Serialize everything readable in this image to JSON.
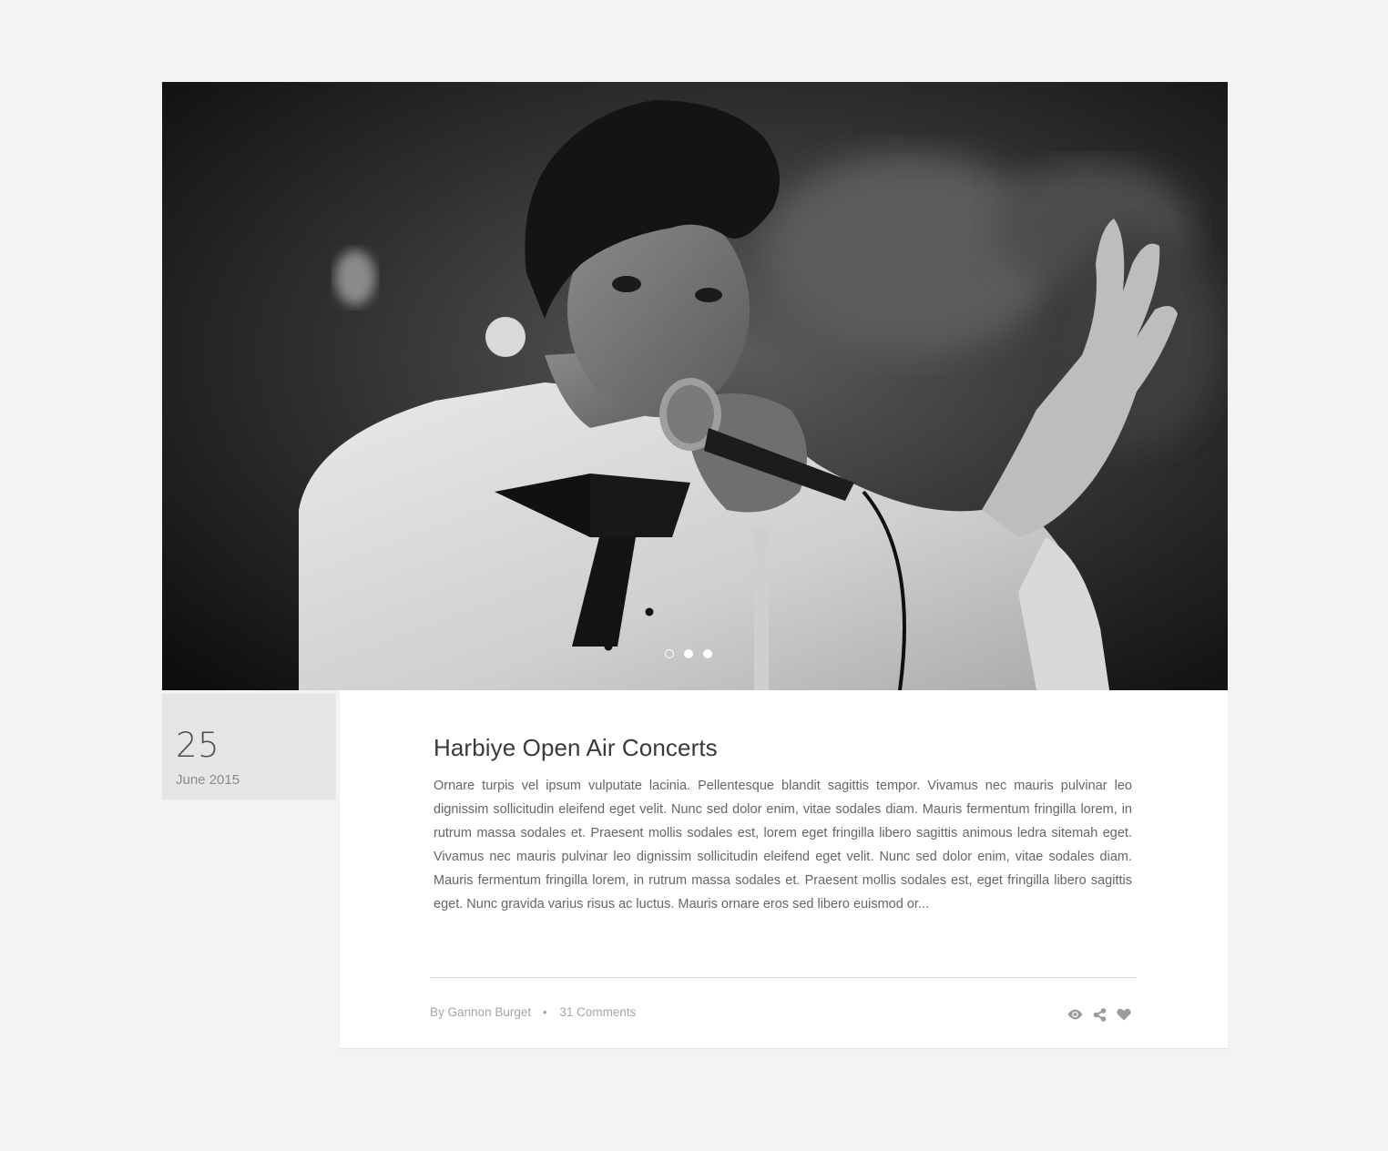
{
  "hero": {
    "image_alt": "Black and white photo of a singer performing into a microphone",
    "slider_dots": [
      {
        "state": "inactive"
      },
      {
        "state": "active"
      },
      {
        "state": "active"
      }
    ]
  },
  "post": {
    "date_day": "25",
    "date_month_year": "June 2015",
    "title": "Harbiye Open Air Concerts",
    "excerpt": "Ornare turpis vel ipsum vulputate lacinia. Pellentesque blandit sagittis tempor. Vivamus nec mauris pulvinar leo dignissim sollicitudin eleifend eget velit. Nunc sed dolor enim, vitae sodales diam. Mauris fermentum fringilla lorem, in rutrum massa sodales et. Praesent mollis sodales est, lorem eget fringilla libero sagittis animous ledra sitemah eget. Vivamus nec mauris pulvinar leo dignissim sollicitudin eleifend eget velit. Nunc sed dolor enim, vitae sodales diam. Mauris fermentum fringilla lorem, in rutrum massa sodales et. Praesent mollis sodales est, eget fringilla libero sagittis eget. Nunc gravida varius risus ac luctus. Mauris ornare eros sed libero euismod or...",
    "author_prefix": "By",
    "author": "Gannon Burget",
    "separator": "•",
    "comments": "31 Comments"
  },
  "actions": [
    {
      "icon": "eye-icon"
    },
    {
      "icon": "share-icon"
    },
    {
      "icon": "heart-icon"
    }
  ],
  "colors": {
    "page_background": "#f3f3f3",
    "card_background": "#ffffff",
    "date_box_background": "#e6e6e6",
    "muted_text": "#a5a5a5",
    "icon_gray": "#9b9b9b"
  }
}
